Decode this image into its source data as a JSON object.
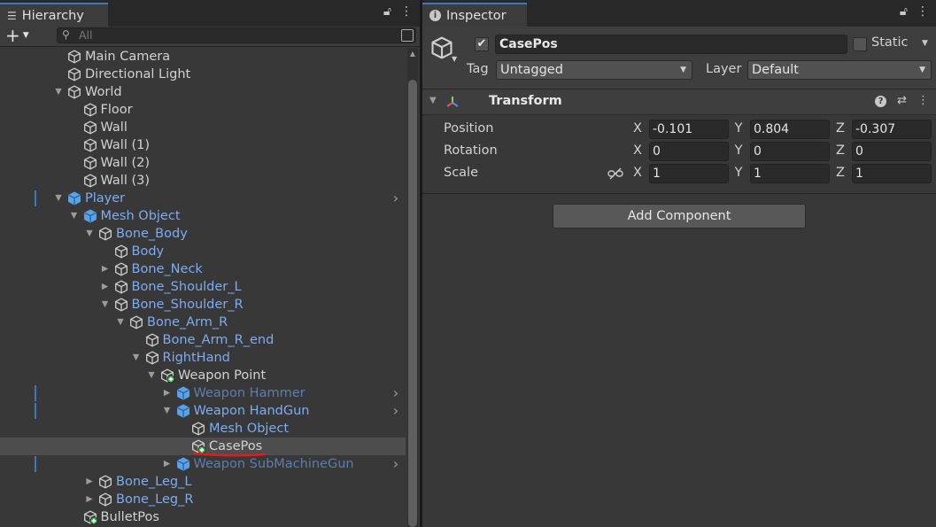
{
  "hierarchy": {
    "tab_title": "Hierarchy",
    "search_placeholder": "All",
    "rows": [
      {
        "label": "Main Camera",
        "depth": 0,
        "arrow": "",
        "icon": "cube",
        "style": "normal"
      },
      {
        "label": "Directional Light",
        "depth": 0,
        "arrow": "",
        "icon": "cube",
        "style": "normal"
      },
      {
        "label": "World",
        "depth": 0,
        "arrow": "expanded",
        "icon": "cube",
        "style": "normal"
      },
      {
        "label": "Floor",
        "depth": 1,
        "arrow": "",
        "icon": "cube",
        "style": "normal"
      },
      {
        "label": "Wall",
        "depth": 1,
        "arrow": "",
        "icon": "cube",
        "style": "normal"
      },
      {
        "label": "Wall (1)",
        "depth": 1,
        "arrow": "",
        "icon": "cube",
        "style": "normal"
      },
      {
        "label": "Wall (2)",
        "depth": 1,
        "arrow": "",
        "icon": "cube",
        "style": "normal"
      },
      {
        "label": "Wall (3)",
        "depth": 1,
        "arrow": "",
        "icon": "cube",
        "style": "normal"
      },
      {
        "label": "Player",
        "depth": 0,
        "arrow": "expanded",
        "icon": "prefab",
        "style": "blue",
        "chevron": true,
        "mark": true
      },
      {
        "label": "Mesh Object",
        "depth": 1,
        "arrow": "expanded",
        "icon": "prefab",
        "style": "blue"
      },
      {
        "label": "Bone_Body",
        "depth": 2,
        "arrow": "expanded",
        "icon": "cube",
        "style": "blue"
      },
      {
        "label": "Body",
        "depth": 3,
        "arrow": "",
        "icon": "cube",
        "style": "blue"
      },
      {
        "label": "Bone_Neck",
        "depth": 3,
        "arrow": "collapsed",
        "icon": "cube",
        "style": "blue"
      },
      {
        "label": "Bone_Shoulder_L",
        "depth": 3,
        "arrow": "collapsed",
        "icon": "cube",
        "style": "blue"
      },
      {
        "label": "Bone_Shoulder_R",
        "depth": 3,
        "arrow": "expanded",
        "icon": "cube",
        "style": "blue"
      },
      {
        "label": "Bone_Arm_R",
        "depth": 4,
        "arrow": "expanded",
        "icon": "cube",
        "style": "blue"
      },
      {
        "label": "Bone_Arm_R_end",
        "depth": 5,
        "arrow": "",
        "icon": "cube",
        "style": "blue"
      },
      {
        "label": "RightHand",
        "depth": 5,
        "arrow": "expanded",
        "icon": "cube",
        "style": "blue"
      },
      {
        "label": "Weapon Point",
        "depth": 6,
        "arrow": "expanded",
        "icon": "cube-added",
        "style": "normal"
      },
      {
        "label": "Weapon Hammer",
        "depth": 7,
        "arrow": "collapsed",
        "icon": "prefab",
        "style": "dim",
        "chevron": true,
        "mark": true
      },
      {
        "label": "Weapon HandGun",
        "depth": 7,
        "arrow": "expanded",
        "icon": "prefab",
        "style": "blue",
        "chevron": true,
        "mark": true
      },
      {
        "label": "Mesh Object",
        "depth": 8,
        "arrow": "",
        "icon": "cube",
        "style": "blue"
      },
      {
        "label": "CasePos",
        "depth": 8,
        "arrow": "",
        "icon": "cube-added",
        "style": "normal",
        "selected": true
      },
      {
        "label": "Weapon SubMachineGun",
        "depth": 7,
        "arrow": "collapsed",
        "icon": "prefab",
        "style": "dim",
        "chevron": true,
        "mark": true
      },
      {
        "label": "Bone_Leg_L",
        "depth": 2,
        "arrow": "collapsed",
        "icon": "cube",
        "style": "blue"
      },
      {
        "label": "Bone_Leg_R",
        "depth": 2,
        "arrow": "collapsed",
        "icon": "cube",
        "style": "blue"
      },
      {
        "label": "BulletPos",
        "depth": 1,
        "arrow": "",
        "icon": "cube-added",
        "style": "normal"
      }
    ]
  },
  "inspector": {
    "tab_title": "Inspector",
    "object_name": "CasePos",
    "static_label": "Static",
    "tag_label": "Tag",
    "tag_value": "Untagged",
    "layer_label": "Layer",
    "layer_value": "Default",
    "component_title": "Transform",
    "position_label": "Position",
    "rotation_label": "Rotation",
    "scale_label": "Scale",
    "axis_x": "X",
    "axis_y": "Y",
    "axis_z": "Z",
    "position": {
      "x": "-0.101",
      "y": "0.804",
      "z": "-0.307"
    },
    "rotation": {
      "x": "0",
      "y": "0",
      "z": "0"
    },
    "scale": {
      "x": "1",
      "y": "1",
      "z": "1"
    },
    "add_component_label": "Add Component"
  },
  "colors": {
    "panel_bg": "#383838",
    "prefab_blue": "#7cacf1",
    "selection": "#4d4d4d",
    "accent": "#3a79bb",
    "annotation_red": "#e21c1c",
    "added_badge": "#3fb34f"
  }
}
